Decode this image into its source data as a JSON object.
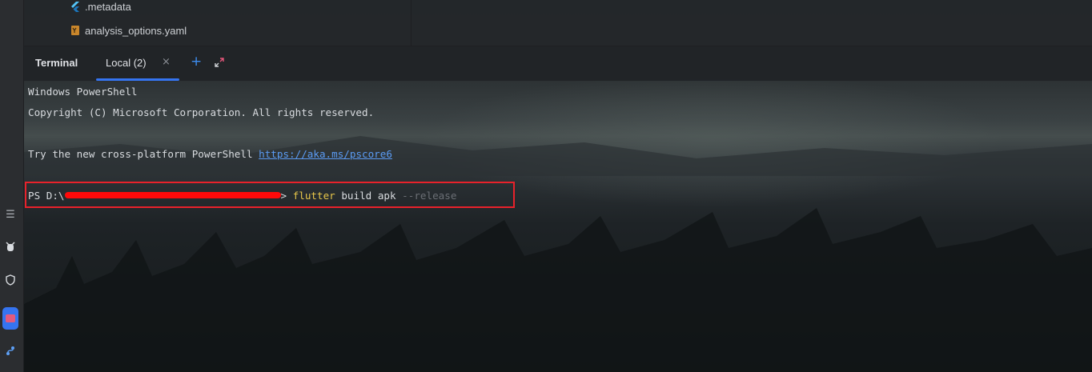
{
  "project_tree": {
    "items": [
      {
        "icon": "flutter-icon",
        "label": ".metadata"
      },
      {
        "icon": "yaml-file-icon",
        "label": "analysis_options.yaml"
      }
    ]
  },
  "terminal": {
    "title": "Terminal",
    "tabs": [
      {
        "label": "Local (2)",
        "active": true
      }
    ],
    "close_glyph": "×",
    "add_glyph": "+",
    "lines": {
      "line1": "Windows PowerShell",
      "line2": "Copyright (C) Microsoft Corporation. All rights reserved.",
      "line3_prefix": "Try the new cross-platform PowerShell ",
      "line3_link": "https://aka.ms/pscore6",
      "prompt_prefix": "PS D:\\",
      "prompt_suffix": ">",
      "cmd_flutter": "flutter",
      "cmd_rest": " build apk ",
      "cmd_flag": "--release"
    }
  },
  "left_strip": {
    "icons": [
      "structure-icon",
      "bug-icon",
      "shield-icon",
      "app-icon",
      "git-icon"
    ]
  },
  "colors": {
    "accent": "#3574f0",
    "highlight_border": "#e8222b",
    "redaction": "#ff0a0a",
    "link": "#5b9cf5",
    "command": "#e8c74a"
  }
}
